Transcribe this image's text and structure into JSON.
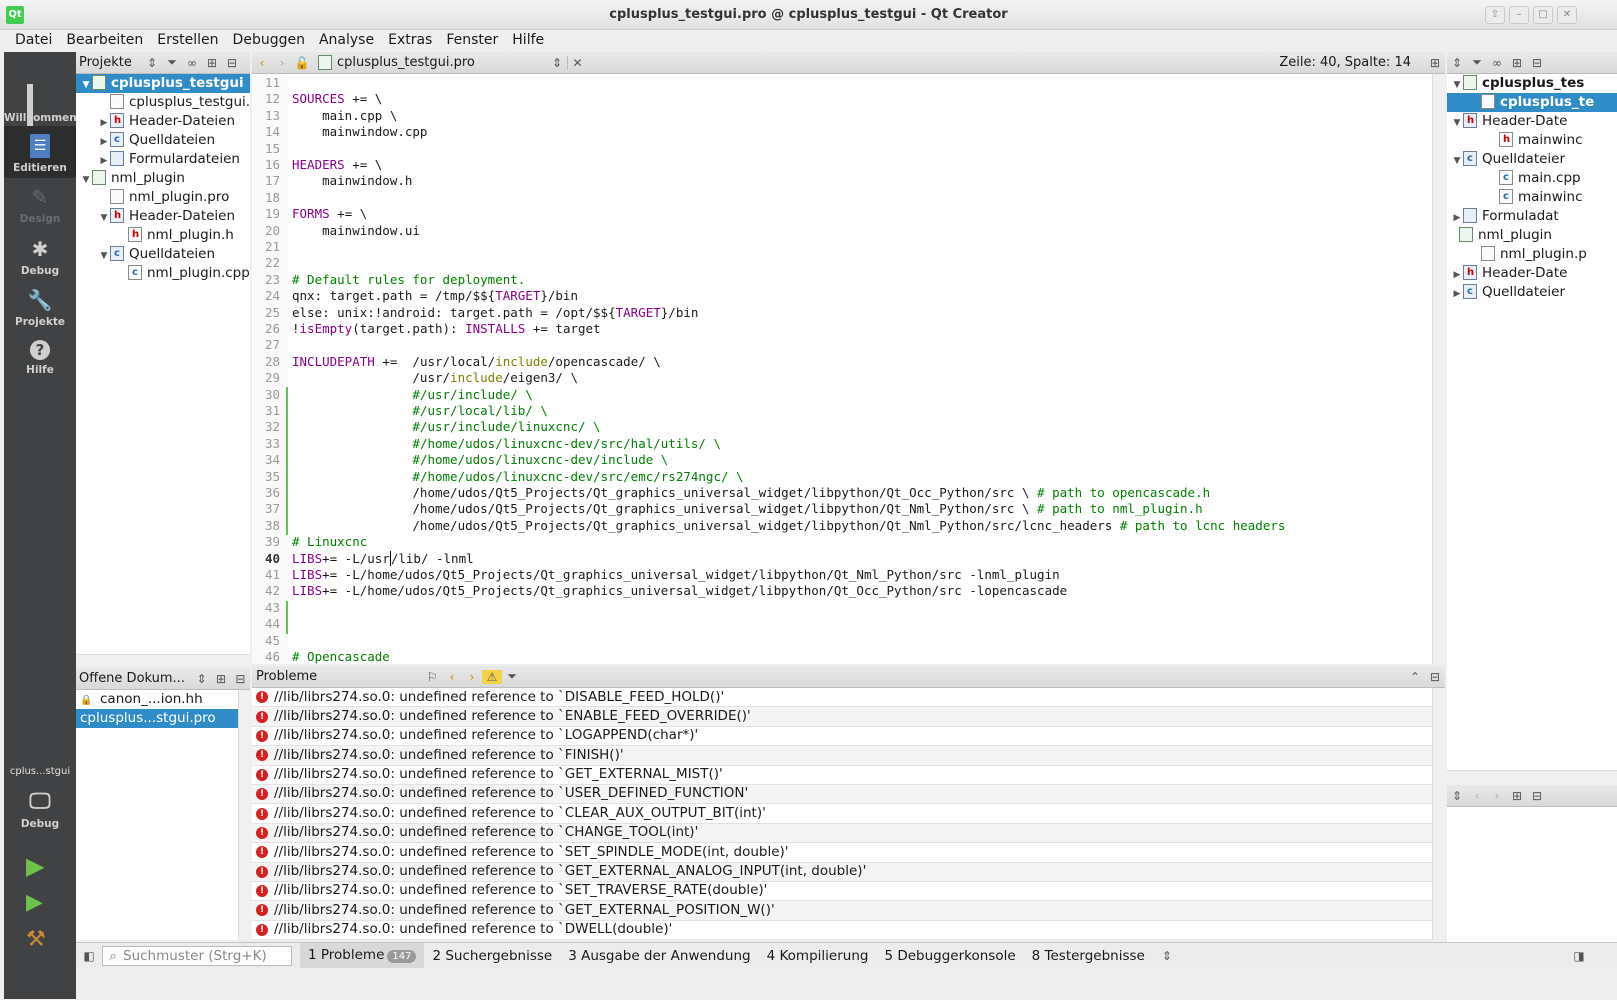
{
  "window": {
    "title": "cplusplus_testgui.pro @ cplusplus_testgui - Qt Creator",
    "logo": "Qt"
  },
  "menu": [
    "Datei",
    "Bearbeiten",
    "Erstellen",
    "Debuggen",
    "Analyse",
    "Extras",
    "Fenster",
    "Hilfe"
  ],
  "modes": [
    {
      "label": "Willkommen",
      "icon": "grid-icon"
    },
    {
      "label": "Editieren",
      "icon": "edit-icon"
    },
    {
      "label": "Design",
      "icon": "design-icon"
    },
    {
      "label": "Debug",
      "icon": "bug-icon"
    },
    {
      "label": "Projekte",
      "icon": "wrench-icon"
    },
    {
      "label": "Hilfe",
      "icon": "help-icon"
    }
  ],
  "kit": {
    "project": "cplus...stgui",
    "label": "Debug"
  },
  "projects_panel": {
    "title": "Projekte",
    "tree": [
      {
        "label": "cplusplus_testgui",
        "level": 0,
        "arrow": "▼",
        "icon": "proj",
        "selected": true
      },
      {
        "label": "cplusplus_testgui.pro",
        "level": 1,
        "arrow": "",
        "icon": "file"
      },
      {
        "label": "Header-Dateien",
        "level": 1,
        "arrow": "▶",
        "icon": "hfolder"
      },
      {
        "label": "Quelldateien",
        "level": 1,
        "arrow": "▶",
        "icon": "cfolder"
      },
      {
        "label": "Formulardateien",
        "level": 1,
        "arrow": "▶",
        "icon": "fold"
      },
      {
        "label": "nml_plugin",
        "level": 0,
        "arrow": "▼",
        "icon": "proj"
      },
      {
        "label": "nml_plugin.pro",
        "level": 1,
        "arrow": "",
        "icon": "file"
      },
      {
        "label": "Header-Dateien",
        "level": 1,
        "arrow": "▼",
        "icon": "hfolder"
      },
      {
        "label": "nml_plugin.h",
        "level": 2,
        "arrow": "",
        "icon": "h"
      },
      {
        "label": "Quelldateien",
        "level": 1,
        "arrow": "▼",
        "icon": "cfolder"
      },
      {
        "label": "nml_plugin.cpp",
        "level": 2,
        "arrow": "",
        "icon": "c"
      }
    ]
  },
  "open_docs": {
    "title": "Offene Dokum...",
    "items": [
      {
        "label": "canon_...ion.hh",
        "locked": true
      },
      {
        "label": "cplusplus...stgui.pro",
        "selected": true
      }
    ]
  },
  "editor": {
    "file": "cplusplus_testgui.pro",
    "position": "Zeile: 40, Spalte: 14",
    "lines": [
      {
        "n": "11",
        "html": ""
      },
      {
        "n": "12",
        "html": "<span class='kw'>SOURCES</span> += \\"
      },
      {
        "n": "13",
        "html": "    main.cpp \\"
      },
      {
        "n": "14",
        "html": "    mainwindow.cpp"
      },
      {
        "n": "15",
        "html": ""
      },
      {
        "n": "16",
        "html": "<span class='kw'>HEADERS</span> += \\"
      },
      {
        "n": "17",
        "html": "    mainwindow.h"
      },
      {
        "n": "18",
        "html": ""
      },
      {
        "n": "19",
        "html": "<span class='kw'>FORMS</span> += \\"
      },
      {
        "n": "20",
        "html": "    mainwindow.ui"
      },
      {
        "n": "21",
        "html": ""
      },
      {
        "n": "22",
        "html": ""
      },
      {
        "n": "23",
        "html": "<span class='cm'># Default rules for deployment.</span>"
      },
      {
        "n": "24",
        "html": "qnx: target.path = /tmp/$${<span class='kw'>TARGET</span>}/bin"
      },
      {
        "n": "25",
        "html": "else: unix:!android: target.path = /opt/$${<span class='kw'>TARGET</span>}/bin"
      },
      {
        "n": "26",
        "html": "!<span class='kw'>isEmpty</span>(target.path): <span class='kw'>INSTALLS</span> += target"
      },
      {
        "n": "27",
        "html": ""
      },
      {
        "n": "28",
        "html": "<span class='kw'>INCLUDEPATH</span> +=  /usr/local/<span class='fn'>include</span>/opencascade/ \\"
      },
      {
        "n": "29",
        "html": "                /usr/<span class='fn'>include</span>/eigen3/ \\"
      },
      {
        "n": "30",
        "html": "                <span class='cm'>#/usr/include/ \\</span>"
      },
      {
        "n": "31",
        "html": "                <span class='cm'>#/usr/local/lib/ \\</span>"
      },
      {
        "n": "32",
        "html": "                <span class='cm'>#/usr/include/linuxcnc/ \\</span>"
      },
      {
        "n": "33",
        "html": "                <span class='cm'>#/home/udos/linuxcnc-dev/src/hal/utils/ \\</span>"
      },
      {
        "n": "34",
        "html": "                <span class='cm'>#/home/udos/linuxcnc-dev/include \\</span>"
      },
      {
        "n": "35",
        "html": "                <span class='cm'>#/home/udos/linuxcnc-dev/src/emc/rs274ngc/ \\</span>"
      },
      {
        "n": "36",
        "html": "                /home/udos/Qt5_Projects/Qt_graphics_universal_widget/libpython/Qt_Occ_Python/src \\ <span class='cm'># path to opencascade.h</span>"
      },
      {
        "n": "37",
        "html": "                /home/udos/Qt5_Projects/Qt_graphics_universal_widget/libpython/Qt_Nml_Python/src \\ <span class='cm'># path to nml_plugin.h</span>"
      },
      {
        "n": "38",
        "html": "                /home/udos/Qt5_Projects/Qt_graphics_universal_widget/libpython/Qt_Nml_Python/src/lcnc_headers <span class='cm'># path to lcnc headers</span>"
      },
      {
        "n": "39",
        "html": "<span class='cm'># Linuxcnc</span>"
      },
      {
        "n": "40",
        "html": "<span class='kw'>LIBS</span>+= -L/usr<span style='border-left:1px solid #000'></span>/lib/ -lnml",
        "current": true
      },
      {
        "n": "41",
        "html": "<span class='kw'>LIBS</span>+= -L/home/udos/Qt5_Projects/Qt_graphics_universal_widget/libpython/Qt_Nml_Python/src -lnml_plugin"
      },
      {
        "n": "42",
        "html": "<span class='kw'>LIBS</span>+= -L/home/udos/Qt5_Projects/Qt_graphics_universal_widget/libpython/Qt_Occ_Python/src -lopencascade"
      },
      {
        "n": "43",
        "html": ""
      },
      {
        "n": "44",
        "html": ""
      },
      {
        "n": "45",
        "html": ""
      },
      {
        "n": "46",
        "html": "<span class='cm'># Opencascade</span>"
      }
    ]
  },
  "outline": {
    "tree": [
      {
        "label": "cplusplus_tes",
        "level": 0,
        "arrow": "▼",
        "icon": "proj",
        "bold": true
      },
      {
        "label": "cplusplus_te",
        "level": 1,
        "arrow": "",
        "icon": "file",
        "selected": true
      },
      {
        "label": "Header-Date",
        "level": 0,
        "arrow": "▼",
        "icon": "hfolder"
      },
      {
        "label": "mainwinc",
        "level": 2,
        "arrow": "",
        "icon": "h"
      },
      {
        "label": "Quelldateier",
        "level": 0,
        "arrow": "▼",
        "icon": "cfolder"
      },
      {
        "label": "main.cpp",
        "level": 2,
        "arrow": "",
        "icon": "c"
      },
      {
        "label": "mainwinc",
        "level": 2,
        "arrow": "",
        "icon": "c"
      },
      {
        "label": "Formuladat",
        "level": 0,
        "arrow": "▶",
        "icon": "fold"
      },
      {
        "label": "nml_plugin",
        "level": -1,
        "arrow": "",
        "icon": "proj"
      },
      {
        "label": "nml_plugin.p",
        "level": 1,
        "arrow": "",
        "icon": "file"
      },
      {
        "label": "Header-Date",
        "level": 0,
        "arrow": "▶",
        "icon": "hfolder"
      },
      {
        "label": "Quelldateier",
        "level": 0,
        "arrow": "▶",
        "icon": "cfolder"
      }
    ]
  },
  "problems": {
    "title": "Probleme",
    "items": [
      "//lib/librs274.so.0: undefined reference to `DISABLE_FEED_HOLD()'",
      "//lib/librs274.so.0: undefined reference to `ENABLE_FEED_OVERRIDE()'",
      "//lib/librs274.so.0: undefined reference to `LOGAPPEND(char*)'",
      "//lib/librs274.so.0: undefined reference to `FINISH()'",
      "//lib/librs274.so.0: undefined reference to `GET_EXTERNAL_MIST()'",
      "//lib/librs274.so.0: undefined reference to `USER_DEFINED_FUNCTION'",
      "//lib/librs274.so.0: undefined reference to `CLEAR_AUX_OUTPUT_BIT(int)'",
      "//lib/librs274.so.0: undefined reference to `CHANGE_TOOL(int)'",
      "//lib/librs274.so.0: undefined reference to `SET_SPINDLE_MODE(int, double)'",
      "//lib/librs274.so.0: undefined reference to `GET_EXTERNAL_ANALOG_INPUT(int, double)'",
      "//lib/librs274.so.0: undefined reference to `SET_TRAVERSE_RATE(double)'",
      "//lib/librs274.so.0: undefined reference to `GET_EXTERNAL_POSITION_W()'",
      "//lib/librs274.so.0: undefined reference to `DWELL(double)'"
    ]
  },
  "statusbar": {
    "search_placeholder": "Suchmuster (Strg+K)",
    "tabs": [
      {
        "label": "1 Probleme",
        "badge": "147",
        "active": true
      },
      {
        "label": "2 Suchergebnisse"
      },
      {
        "label": "3 Ausgabe der Anwendung"
      },
      {
        "label": "4 Kompilierung"
      },
      {
        "label": "5 Debuggerkonsole"
      },
      {
        "label": "8 Testergebnisse"
      }
    ]
  }
}
